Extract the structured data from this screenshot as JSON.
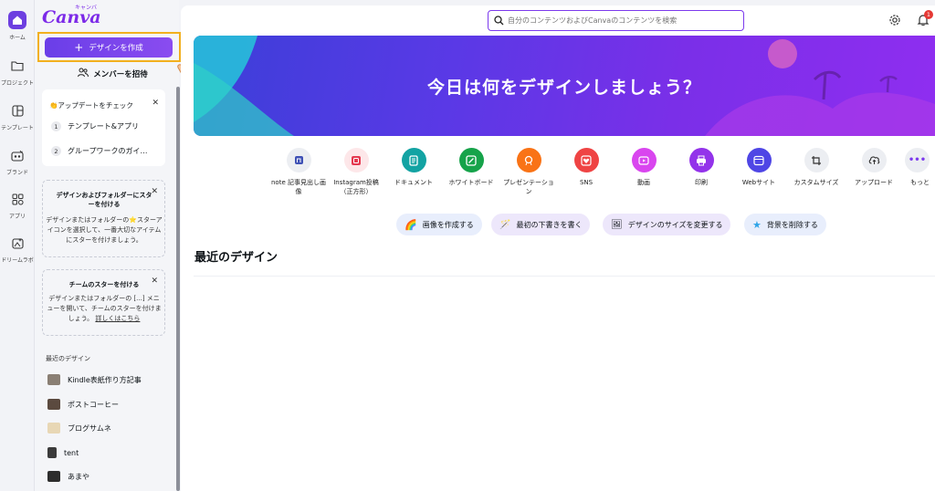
{
  "rail": {
    "items": [
      {
        "label": "ホーム",
        "icon": "home-icon"
      },
      {
        "label": "プロジェクト",
        "icon": "folder-icon"
      },
      {
        "label": "テンプレート",
        "icon": "template-icon"
      },
      {
        "label": "ブランド",
        "icon": "brand-icon"
      },
      {
        "label": "アプリ",
        "icon": "apps-icon"
      },
      {
        "label": "ドリームラボ",
        "icon": "dream-lab-icon"
      }
    ]
  },
  "panel": {
    "logo": "Canva",
    "logo_kana": "キャンバ",
    "create_button": "デザインを作成",
    "invite_button": "メンバーを招待",
    "updates": {
      "title": "👏アップデートをチェック",
      "items": [
        {
          "num": "1",
          "label": "テンプレート&アプリ"
        },
        {
          "num": "2",
          "label": "グループワークのガイ…"
        }
      ]
    },
    "tip1": {
      "title": "デザインおよびフォルダーにスターを付ける",
      "body": "デザインまたはフォルダーの⭐スターアイコンを選択して、一番大切なアイテムにスターを付けましょう。"
    },
    "tip2": {
      "title": "チームのスターを付ける",
      "body": "デザインまたはフォルダーの [...] メニューを開いて、チームのスターを付けましょう。",
      "link": "詳しくはこちら"
    },
    "recent_heading": "最近のデザイン",
    "recent": [
      {
        "label": "Kindle表紙作り方記事",
        "color": "#8a7f74"
      },
      {
        "label": "ポストコーヒー",
        "color": "#5b4a3f"
      },
      {
        "label": "ブログサムネ",
        "color": "#e8d7b5"
      },
      {
        "label": "tent",
        "color": "#3b3b3b"
      },
      {
        "label": "あまや",
        "color": "#2d2d2d"
      }
    ]
  },
  "header": {
    "search_placeholder": "自分のコンテンツおよびCanvaのコンテンツを検索",
    "notification_count": "1"
  },
  "hero": {
    "title": "今日は何をデザインしましょう？"
  },
  "content_types": [
    {
      "label": "note 記事見出し画像",
      "icon": "note-icon",
      "color": "#eceef2",
      "fg": "#3f51b5"
    },
    {
      "label": "Instagram投稿（正方形）",
      "icon": "instagram-icon",
      "color": "#fde7e9",
      "fg": "#e53950"
    },
    {
      "label": "ドキュメント",
      "icon": "document-icon",
      "color": "#13a3a3",
      "fg": "#ffffff"
    },
    {
      "label": "ホワイトボード",
      "icon": "whiteboard-icon",
      "color": "#16a34a",
      "fg": "#ffffff"
    },
    {
      "label": "プレゼンテーション",
      "icon": "presentation-icon",
      "color": "#f97316",
      "fg": "#ffffff"
    },
    {
      "label": "SNS",
      "icon": "social-heart-icon",
      "color": "#ef4444",
      "fg": "#ffffff"
    },
    {
      "label": "動画",
      "icon": "video-icon",
      "color": "#d946ef",
      "fg": "#ffffff"
    },
    {
      "label": "印刷",
      "icon": "print-icon",
      "color": "#9333ea",
      "fg": "#ffffff"
    },
    {
      "label": "Webサイト",
      "icon": "website-icon",
      "color": "#4f46e5",
      "fg": "#ffffff"
    },
    {
      "label": "カスタムサイズ",
      "icon": "custom-size-icon",
      "color": "#eceef2",
      "fg": "#333333"
    },
    {
      "label": "アップロード",
      "icon": "upload-icon",
      "color": "#eceef2",
      "fg": "#333333"
    },
    {
      "label": "もっと",
      "icon": "more-icon",
      "color": "#eceef2",
      "fg": "#7c3aed"
    }
  ],
  "chips": [
    {
      "label": "画像を作成する",
      "icon": "rainbow-icon"
    },
    {
      "label": "最初の下書きを書く",
      "icon": "magic-wand-icon"
    },
    {
      "label": "デザインのサイズを変更する",
      "icon": "resize-icon"
    },
    {
      "label": "背景を削除する",
      "icon": "star-icon"
    }
  ],
  "main": {
    "recent_title": "最近のデザイン"
  },
  "colors": {
    "accent": "#7c3aed",
    "highlight": "#f2b01e"
  }
}
